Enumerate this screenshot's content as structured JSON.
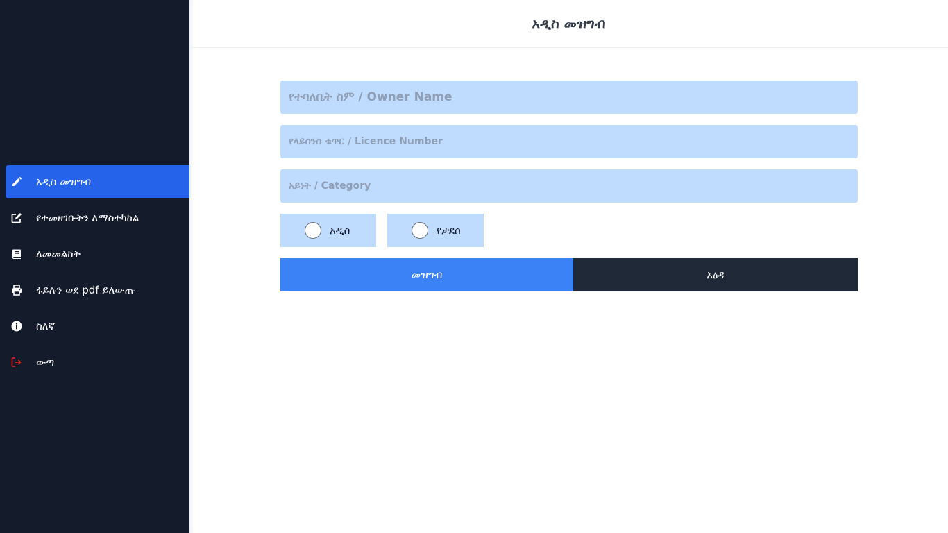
{
  "header": {
    "title": "አዲስ መዝግብ"
  },
  "sidebar": {
    "items": [
      {
        "label": "አዲስ መዝግብ",
        "icon": "pencil-icon",
        "active": true
      },
      {
        "label": "የተመዘገቡትን ለማስተካከል",
        "icon": "edit-icon"
      },
      {
        "label": "ለመመልከት",
        "icon": "book-icon"
      },
      {
        "label": "ፋይሉን ወደ pdf ይለውጡ",
        "icon": "printer-icon"
      },
      {
        "label": "ስለኛ",
        "icon": "info-icon"
      },
      {
        "label": "ውጣ",
        "icon": "logout-icon"
      }
    ]
  },
  "form": {
    "owner_placeholder": "የተባለቤት ስም / Owner Name",
    "licence_placeholder": "የላይሰንስ ቁጥር / Licence Number",
    "category_placeholder": "አይነት / Category",
    "radio_new": "አዲስ",
    "radio_renewed": "የታደሰ",
    "submit_label": "መዝግብ",
    "cancel_label": "አፅዳ"
  },
  "colors": {
    "sidebar_bg": "#141b2b",
    "active_item": "#2563eb",
    "field_bg": "#bfdbfe",
    "submit_bg": "#3b82f6",
    "cancel_bg": "#1f2937",
    "logout_icon": "#dc2626"
  }
}
